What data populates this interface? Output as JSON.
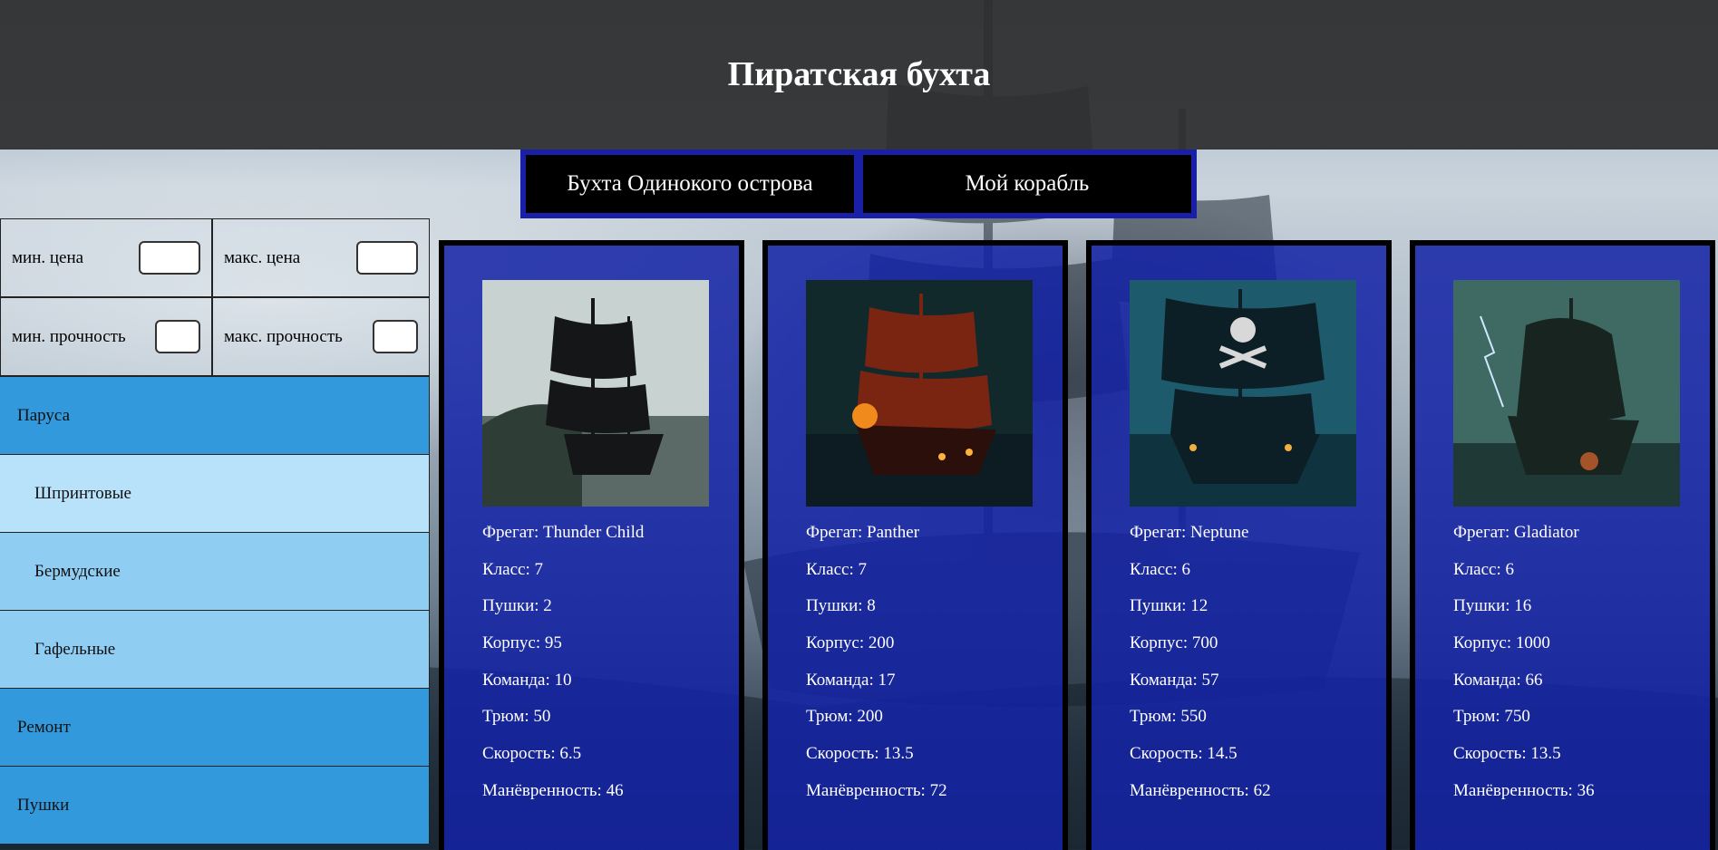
{
  "header": {
    "title": "Пиратская бухта"
  },
  "nav": {
    "tabs": [
      {
        "label": "Бухта Одинокого острова"
      },
      {
        "label": "Мой корабль"
      }
    ]
  },
  "filters": {
    "min_price": {
      "label": "мин. цена",
      "value": ""
    },
    "max_price": {
      "label": "макс. цена",
      "value": ""
    },
    "min_durability": {
      "label": "мин. прочность",
      "value": ""
    },
    "max_durability": {
      "label": "макс. прочность",
      "value": ""
    }
  },
  "sidebar": {
    "categories": [
      {
        "label": "Паруса",
        "level": "main"
      },
      {
        "label": "Шпринтовые",
        "level": "sub"
      },
      {
        "label": "Бермудские",
        "level": "sub"
      },
      {
        "label": "Гафельные",
        "level": "sub"
      },
      {
        "label": "Ремонт",
        "level": "main"
      },
      {
        "label": "Пушки",
        "level": "main"
      }
    ]
  },
  "ships": [
    {
      "name": "Фрегат: Thunder Child",
      "class": "Класс: 7",
      "guns": "Пушки: 2",
      "hull": "Корпус: 95",
      "crew": "Команда: 10",
      "hold": "Трюм: 50",
      "speed": "Скорость: 6.5",
      "maneuver": "Манёвренность: 46"
    },
    {
      "name": "Фрегат: Panther",
      "class": "Класс: 7",
      "guns": "Пушки: 8",
      "hull": "Корпус: 200",
      "crew": "Команда: 17",
      "hold": "Трюм: 200",
      "speed": "Скорость: 13.5",
      "maneuver": "Манёвренность: 72"
    },
    {
      "name": "Фрегат: Neptune",
      "class": "Класс: 6",
      "guns": "Пушки: 12",
      "hull": "Корпус: 700",
      "crew": "Команда: 57",
      "hold": "Трюм: 550",
      "speed": "Скорость: 14.5",
      "maneuver": "Манёвренность: 62"
    },
    {
      "name": "Фрегат: Gladiator",
      "class": "Класс: 6",
      "guns": "Пушки: 16",
      "hull": "Корпус: 1000",
      "crew": "Команда: 66",
      "hold": "Трюм: 750",
      "speed": "Скорость: 13.5",
      "maneuver": "Манёвренность: 36"
    }
  ],
  "colors": {
    "header_bg": "#2d2d2d",
    "tab_border": "#1a1fa8",
    "card_bg": "#1423a5",
    "sidebar_main": "#3399dd",
    "sidebar_sub": "#8fcdf3"
  }
}
